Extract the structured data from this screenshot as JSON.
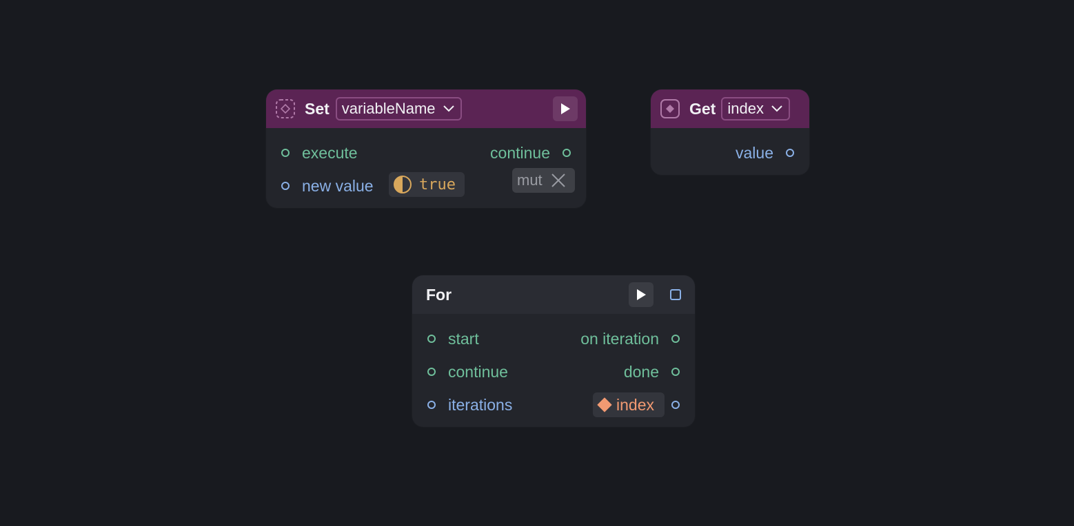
{
  "nodes": {
    "set": {
      "title": "Set",
      "variable": "variableName",
      "inputs": {
        "execute": "execute",
        "new_value": "new value",
        "default_value": "true"
      },
      "outputs": {
        "continue": "continue"
      },
      "mut_tag": "mut"
    },
    "get": {
      "title": "Get",
      "variable": "index",
      "outputs": {
        "value": "value"
      }
    },
    "for": {
      "title": "For",
      "inputs": {
        "start": "start",
        "continue": "continue",
        "iterations": "iterations"
      },
      "outputs": {
        "on_iteration": "on iteration",
        "done": "done",
        "index": "index"
      }
    }
  },
  "colors": {
    "background": "#181a1f",
    "node_body": "#23252b",
    "variable_header": "#5b2454",
    "exec_port": "#6fbf9b",
    "data_port": "#8ab0e6",
    "boolean": "#d9a85c",
    "number": "#f29a72"
  },
  "icons": {
    "set_icon": "dashed-diamond-icon",
    "get_icon": "filled-diamond-icon",
    "run": "play-icon",
    "remove": "close-icon",
    "boolean": "half-circle-icon",
    "number": "diamond-icon"
  }
}
